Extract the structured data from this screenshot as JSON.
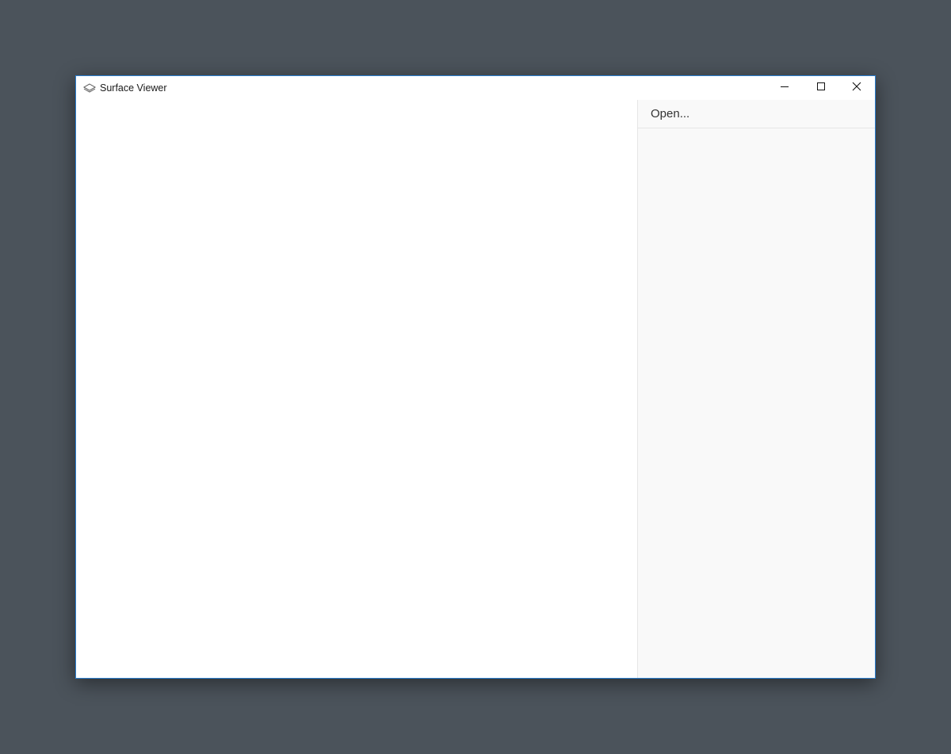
{
  "window": {
    "title": "Surface Viewer",
    "app_icon": "layers-icon",
    "border_color": "#2b7fd1",
    "controls": {
      "minimize_icon": "minimize-icon",
      "maximize_icon": "maximize-icon",
      "close_icon": "close-icon"
    }
  },
  "side_panel": {
    "open_label": "Open..."
  },
  "colors": {
    "desktop": "#4b535b",
    "panel_background": "#f9f9f9"
  }
}
